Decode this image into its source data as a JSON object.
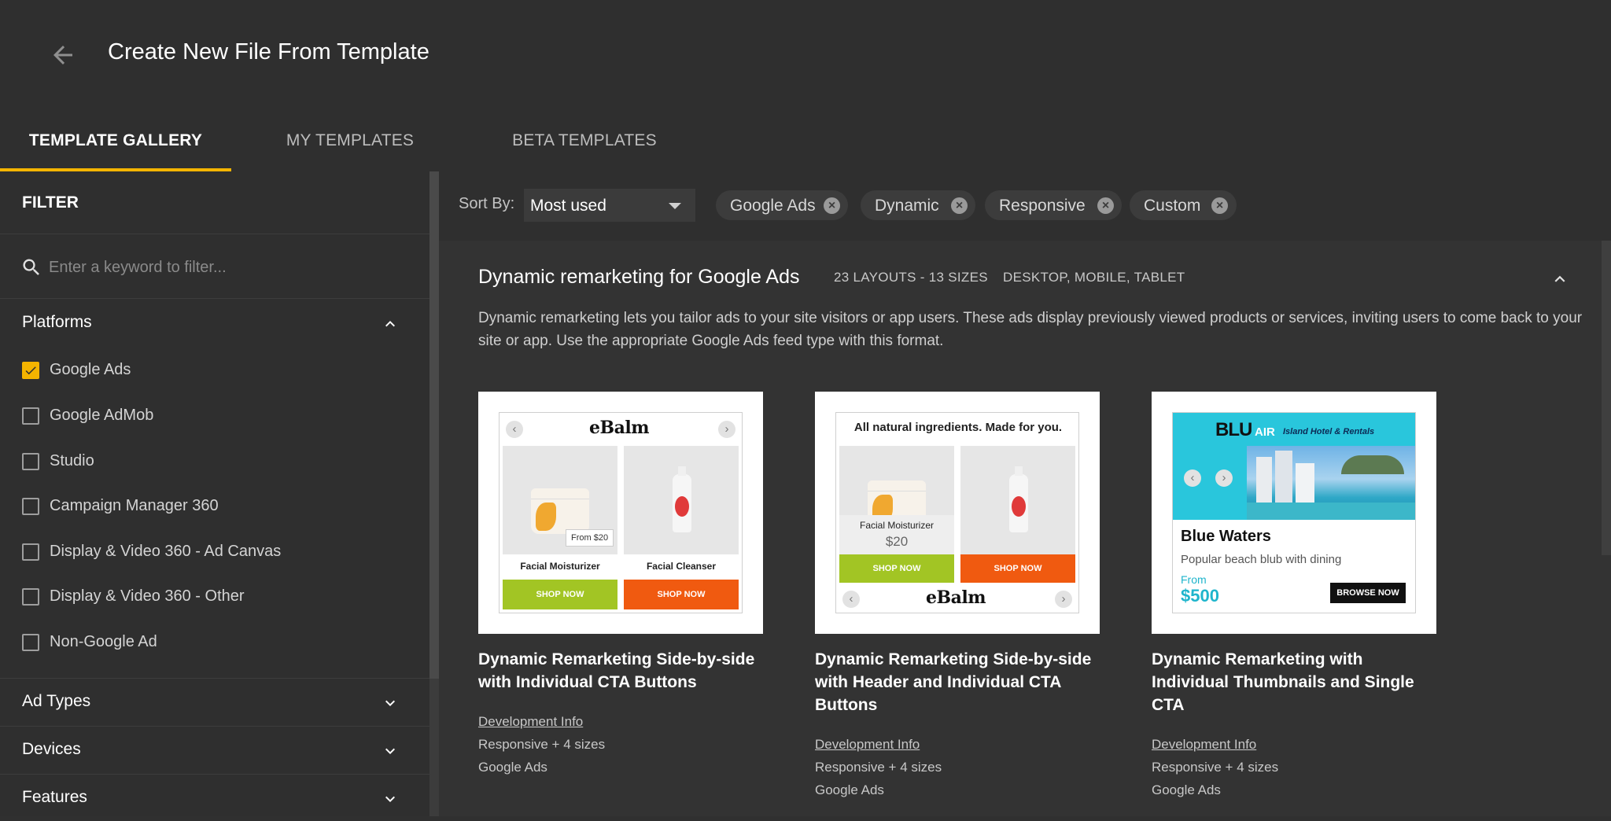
{
  "header": {
    "title": "Create New File From Template",
    "tabs": [
      {
        "label": "TEMPLATE GALLERY",
        "active": true
      },
      {
        "label": "MY TEMPLATES",
        "active": false
      },
      {
        "label": "BETA TEMPLATES",
        "active": false
      }
    ]
  },
  "colors": {
    "accent": "#f4b400",
    "background": "#303030"
  },
  "sidebar": {
    "filter_title": "FILTER",
    "search_placeholder": "Enter a keyword to filter...",
    "platforms": {
      "label": "Platforms",
      "expanded": true,
      "items": [
        {
          "label": "Google Ads",
          "checked": true
        },
        {
          "label": "Google AdMob",
          "checked": false
        },
        {
          "label": "Studio",
          "checked": false
        },
        {
          "label": "Campaign Manager 360",
          "checked": false
        },
        {
          "label": "Display & Video 360 - Ad Canvas",
          "checked": false
        },
        {
          "label": "Display & Video 360 - Other",
          "checked": false
        },
        {
          "label": "Non-Google Ad",
          "checked": false
        }
      ]
    },
    "ad_types": {
      "label": "Ad Types",
      "expanded": false
    },
    "devices": {
      "label": "Devices",
      "expanded": false
    },
    "features": {
      "label": "Features",
      "expanded": false
    }
  },
  "toolbar": {
    "sort_label": "Sort By:",
    "sort_value": "Most used",
    "chips": [
      "Google Ads",
      "Dynamic",
      "Responsive",
      "Custom"
    ]
  },
  "section": {
    "title": "Dynamic remarketing for Google Ads",
    "layouts": "23 LAYOUTS - 13 SIZES",
    "devices": "DESKTOP, MOBILE, TABLET",
    "description": "Dynamic remarketing lets you tailor ads to your site visitors or app users. These ads display previously viewed products or services, inviting users to come back to your site or app. Use the appropriate Google Ads feed type with this format."
  },
  "cards": [
    {
      "title": "Dynamic Remarketing Side-by-side with Individual CTA Buttons",
      "link": "Development Info",
      "sizes": "Responsive + 4 sizes",
      "platform": "Google Ads",
      "ad": {
        "logo": "eBalm",
        "price": "From $20",
        "products": [
          "Facial Moisturizer",
          "Facial Cleanser"
        ],
        "cta": "SHOP NOW"
      }
    },
    {
      "title": "Dynamic Remarketing Side-by-side with Header and Individual CTA Buttons",
      "link": "Development Info",
      "sizes": "Responsive + 4 sizes",
      "platform": "Google Ads",
      "ad": {
        "header": "All natural ingredients. Made for you.",
        "logo": "eBalm",
        "product": "Facial Moisturizer",
        "price": "$20",
        "cta": "SHOP NOW"
      }
    },
    {
      "title": "Dynamic Remarketing with Individual Thumbnails and Single CTA",
      "link": "Development Info",
      "sizes": "Responsive + 4 sizes",
      "platform": "Google Ads",
      "ad": {
        "brand_main": "BLU",
        "brand_sub": "AIR",
        "tagline": "Island Hotel & Rentals",
        "headline": "Blue Waters",
        "body": "Popular beach blub with dining",
        "from": "From",
        "price": "$500",
        "cta": "BROWSE NOW"
      }
    }
  ]
}
